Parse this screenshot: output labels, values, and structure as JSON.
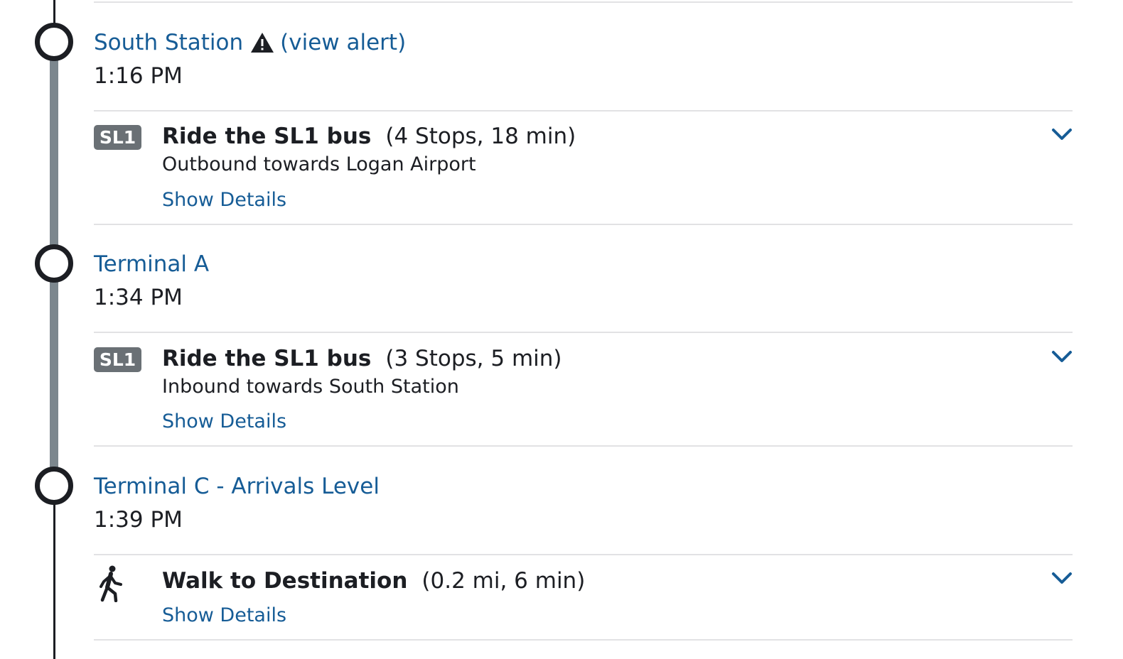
{
  "stops": [
    {
      "name": "South Station",
      "alert_link": "(view alert)",
      "time": "1:16 PM"
    },
    {
      "name": "Terminal A",
      "time": "1:34 PM"
    },
    {
      "name": "Terminal C - Arrivals Level",
      "time": "1:39 PM"
    }
  ],
  "legs": [
    {
      "badge": "SL1",
      "title": "Ride the SL1 bus",
      "meta": "(4 Stops, 18 min)",
      "subtitle": "Outbound towards Logan Airport",
      "details_link": "Show Details"
    },
    {
      "badge": "SL1",
      "title": "Ride the SL1 bus",
      "meta": "(3 Stops, 5 min)",
      "subtitle": "Inbound towards South Station",
      "details_link": "Show Details"
    },
    {
      "icon": "walking-person-icon",
      "title": "Walk to Destination",
      "meta": "(0.2 mi, 6 min)",
      "details_link": "Show Details"
    }
  ],
  "colors": {
    "link": "#165c96",
    "text": "#1c1e23",
    "route_line": "#7c878e",
    "badge_bg": "#6a7075",
    "divider": "#e2e2e4"
  }
}
